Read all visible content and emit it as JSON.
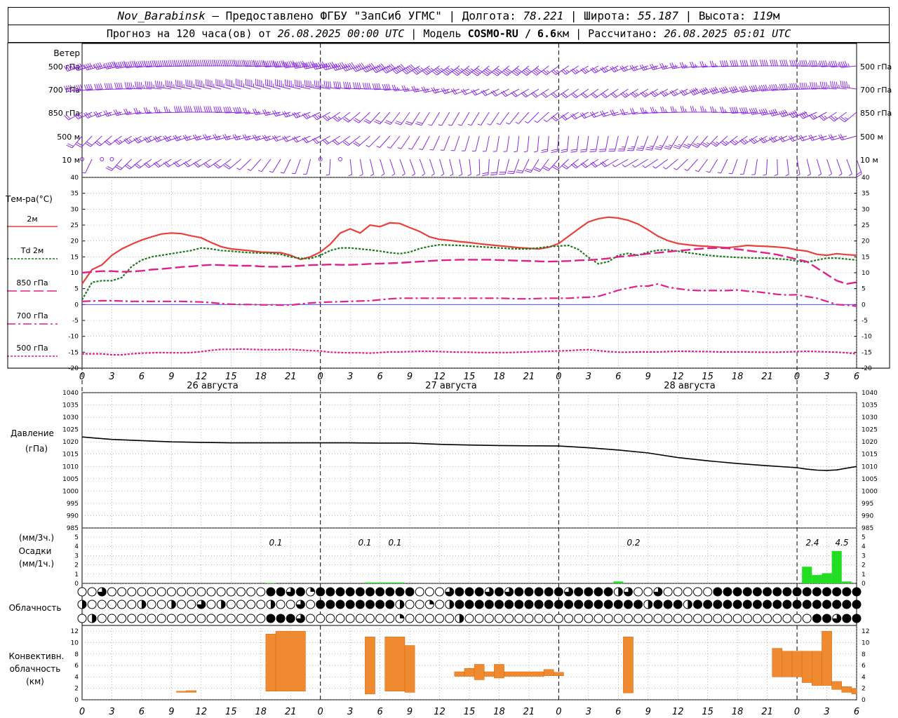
{
  "header": {
    "station": "Nov_Barabinsk",
    "dash": " — ",
    "provider": "Предоставлено ФГБУ \"ЗапСиб УГМС\" | Долгота: ",
    "lon": "78.221",
    "lat_label": " | Широта: ",
    "lat": "55.187",
    "alt_label": " | Высота: ",
    "alt": "119",
    "alt_unit": "м",
    "line2_a": "Прогноз на 120 часа(ов) от ",
    "run_time": "26.08.2025 00:00 UTC",
    "line2_b": " | Модель ",
    "model": "COSMO-RU / 6.6",
    "model_unit": "км",
    "line2_c": " | Рассчитано: ",
    "calc_time": "26.08.2025 05:01 UTC"
  },
  "wind_panel": {
    "title": "Ветер",
    "levels": [
      "500 гПа",
      "700 гПа",
      "850 гПа",
      "500 м",
      "10  м"
    ],
    "color": "#8a2be2"
  },
  "temp_panel": {
    "title": "Тем-ра(°C)",
    "legend": [
      "2м",
      "Td  2м",
      "850 гПа",
      "700 гПа",
      "500 гПа"
    ],
    "yticks": [
      "40",
      "35",
      "30",
      "25",
      "20",
      "15",
      "10",
      "5",
      "0",
      "-5",
      "-10",
      "-15",
      "-20"
    ]
  },
  "pressure_panel": {
    "title": "Давление",
    "unit": "(гПа)",
    "yticks": [
      "1040",
      "1035",
      "1030",
      "1025",
      "1020",
      "1015",
      "1010",
      "1005",
      "1000",
      "995",
      "990",
      "985"
    ]
  },
  "precip_panel": {
    "title_a": "(мм/3ч.)",
    "title_b": "Осадки",
    "title_c": "(мм/1ч.)",
    "yticks": [
      "5",
      "4",
      "3",
      "2",
      "1",
      "0"
    ],
    "labels": [
      "0.1",
      "0.1",
      "0.1",
      "0.2",
      "2.4",
      "4.5"
    ]
  },
  "cloud_panel": {
    "title": "Облачность"
  },
  "conv_panel": {
    "title_a": "Конвективн.",
    "title_b": "облачность",
    "title_c": "(км)",
    "yticks": [
      "12",
      "10",
      "8",
      "6",
      "4",
      "2",
      "0"
    ]
  },
  "time_axis": {
    "hour_labels": [
      "0",
      "3",
      "6",
      "9",
      "12",
      "15",
      "18",
      "21",
      "0",
      "3",
      "6",
      "9",
      "12",
      "15",
      "18",
      "21",
      "0",
      "3",
      "6",
      "9",
      "12",
      "15",
      "18",
      "21",
      "0",
      "3",
      "6"
    ],
    "dates": [
      "26 августа",
      "27 августа",
      "28 августа"
    ]
  },
  "colors": {
    "t2m": "#e8403a",
    "td2m": "#1b7a1b",
    "t850": "#e0208c",
    "wind": "#8a2be2",
    "precip": "#22dd22",
    "conv": "#f08a30"
  },
  "chart_data": [
    {
      "type": "line",
      "title": "Тем-ра(°C)",
      "x_hours": [
        0,
        1,
        2,
        3,
        4,
        5,
        6,
        7,
        8,
        9,
        10,
        11,
        12,
        13,
        14,
        15,
        16,
        17,
        18,
        19,
        20,
        21,
        22,
        23,
        24,
        25,
        26,
        27,
        28,
        29,
        30,
        31,
        32,
        33,
        34,
        35,
        36,
        37,
        38,
        39,
        40,
        41,
        42,
        43,
        44,
        45,
        46,
        47,
        48,
        49,
        50,
        51,
        52,
        53,
        54,
        55,
        56,
        57,
        58,
        59,
        60,
        61,
        62,
        63,
        64,
        65,
        66,
        67,
        68,
        69,
        70,
        71,
        72,
        73,
        74,
        75,
        76,
        77,
        78
      ],
      "ylim": [
        -20,
        40
      ],
      "series": [
        {
          "name": "2м",
          "values": [
            6.5,
            11,
            12.5,
            15.5,
            17.5,
            19,
            20.3,
            21.3,
            22.2,
            22.5,
            22.3,
            21.6,
            21,
            19.5,
            18.2,
            17.5,
            17.2,
            16.9,
            16.5,
            16.4,
            16.3,
            15.5,
            14.2,
            15,
            16.5,
            19,
            22.5,
            23.8,
            22.5,
            25,
            24.5,
            25.7,
            25.5,
            24.2,
            23,
            21.3,
            20.5,
            20.2,
            19.8,
            19.5,
            19.1,
            18.8,
            18.5,
            18.2,
            17.9,
            17.7,
            17.5,
            18,
            19.2,
            21.5,
            23.8,
            26,
            27,
            27.5,
            27.2,
            26.5,
            25.3,
            23.5,
            21.5,
            20.1,
            19.2,
            18.8,
            18.5,
            18.3,
            18.1,
            17.9,
            18.2,
            18.6,
            18.4,
            18.3,
            18.1,
            17.8,
            17.2,
            16.8,
            15.8,
            15.5,
            16,
            15.7,
            15.5
          ]
        },
        {
          "name": "Td  2м",
          "values": [
            1.5,
            7,
            7.5,
            7.5,
            8.5,
            12,
            14,
            15,
            15.5,
            16,
            16.5,
            17,
            17.8,
            17.5,
            17,
            16.8,
            16.5,
            16.3,
            16.2,
            16.1,
            15.8,
            15,
            14.5,
            14.5,
            15.5,
            17,
            17.8,
            17.8,
            17.5,
            17.2,
            16.8,
            16.3,
            16,
            16.5,
            17.6,
            18.3,
            18.8,
            18.7,
            18.6,
            18.4,
            18.2,
            18,
            17.8,
            17.6,
            17.5,
            17.5,
            17.8,
            18.2,
            18.4,
            18.6,
            17.3,
            14.8,
            12.8,
            13.5,
            15.5,
            16.1,
            15.5,
            16.5,
            17.1,
            17.2,
            16.8,
            16.3,
            15.9,
            15.5,
            15.2,
            15,
            14.8,
            14.7,
            14.6,
            14.6,
            14.4,
            14.2,
            13.7,
            13.3,
            14,
            14.6,
            14.6,
            14.3,
            14
          ]
        },
        {
          "name": "850 гПа",
          "values": [
            10,
            10.3,
            10.5,
            10.5,
            10.3,
            10.4,
            10.6,
            11,
            11.2,
            11.5,
            11.8,
            12,
            12.3,
            12.5,
            12.4,
            12.3,
            12.2,
            12.2,
            12,
            11.9,
            11.9,
            12,
            12.2,
            12.4,
            12.5,
            12.6,
            12.5,
            12.5,
            12.6,
            12.8,
            12.9,
            13,
            13.1,
            13.3,
            13.5,
            13.7,
            13.9,
            14,
            14.1,
            14.1,
            14.1,
            14.1,
            14,
            13.9,
            13.8,
            13.7,
            13.6,
            13.5,
            13.6,
            13.7,
            13.9,
            14,
            14.2,
            14.5,
            15,
            15.3,
            15.6,
            16,
            16.3,
            16.6,
            16.9,
            17.2,
            17.5,
            17.7,
            17.8,
            17.7,
            17.4,
            17,
            16.6,
            16.2,
            15.7,
            15,
            14.2,
            13.5,
            11.5,
            9.5,
            7.5,
            6.5,
            7
          ]
        },
        {
          "name": "700 гПа",
          "values": [
            1,
            1.1,
            1.2,
            1.2,
            1.1,
            1,
            1,
            1,
            1,
            1,
            1,
            0.9,
            0.8,
            0.6,
            0.3,
            0.1,
            0,
            0,
            -0.1,
            -0.1,
            -0.2,
            -0.2,
            0.2,
            0.5,
            0.7,
            0.8,
            0.9,
            1,
            1.1,
            1.2,
            1.5,
            1.8,
            2,
            2,
            2,
            2,
            2,
            2,
            2,
            2,
            2,
            2,
            2,
            1.9,
            1.8,
            1.8,
            1.9,
            2,
            2,
            2,
            2.2,
            2.3,
            2.6,
            3.5,
            4.5,
            5.2,
            5.8,
            5.8,
            6.5,
            5.5,
            5,
            4.6,
            4.4,
            4.4,
            4.4,
            4.4,
            4.6,
            4.2,
            4,
            3.6,
            3.2,
            3,
            3.1,
            2.5,
            2,
            1,
            0,
            -0.2,
            -0.5
          ]
        },
        {
          "name": "500 гПа",
          "values": [
            -15.5,
            -15.5,
            -15.5,
            -15.8,
            -15.8,
            -15.5,
            -15.3,
            -15.2,
            -15.1,
            -15.2,
            -15.2,
            -15.1,
            -14.8,
            -14.4,
            -14.1,
            -14.1,
            -14,
            -14.1,
            -14.2,
            -14.2,
            -14.2,
            -14.1,
            -14.3,
            -14.5,
            -14.6,
            -15,
            -15.1,
            -15.2,
            -15.2,
            -15.3,
            -15.1,
            -14.9,
            -14.9,
            -14.8,
            -14.7,
            -14.7,
            -14.8,
            -14.9,
            -15,
            -15,
            -15.1,
            -15.1,
            -15.1,
            -15.1,
            -15,
            -14.9,
            -14.8,
            -14.7,
            -14.6,
            -14.5,
            -14.3,
            -14.2,
            -14.5,
            -14.8,
            -15,
            -15,
            -14.9,
            -14.9,
            -14.9,
            -14.8,
            -14.7,
            -14.7,
            -14.8,
            -14.8,
            -14.9,
            -14.9,
            -14.9,
            -14.9,
            -15,
            -15,
            -15,
            -14.9,
            -14.8,
            -14.7,
            -14.8,
            -14.9,
            -15,
            -15.2,
            -15.5
          ]
        }
      ]
    },
    {
      "type": "line",
      "title": "Давление",
      "ylabel": "(гПа)",
      "ylim": [
        985,
        1040
      ],
      "x_hours": [
        0,
        3,
        6,
        9,
        12,
        15,
        18,
        21,
        24,
        27,
        30,
        33,
        36,
        39,
        42,
        45,
        48,
        51,
        54,
        57,
        60,
        63,
        66,
        69,
        72,
        73,
        74,
        75,
        76,
        77,
        78
      ],
      "series": [
        {
          "name": "Давление",
          "values": [
            1022,
            1021,
            1020.5,
            1020,
            1019.8,
            1019.6,
            1019.6,
            1019.6,
            1019.6,
            1019.6,
            1019.5,
            1019.5,
            1019,
            1018.7,
            1018.5,
            1018.4,
            1018.3,
            1017.6,
            1016.7,
            1015.5,
            1013.6,
            1012.3,
            1011.2,
            1010.3,
            1009.5,
            1008.9,
            1008.5,
            1008.4,
            1008.6,
            1009.3,
            1010
          ]
        }
      ]
    },
    {
      "type": "bar",
      "title": "Осадки",
      "ylabel": "(мм/3ч.) (мм/1ч.)",
      "ylim": [
        0,
        5
      ],
      "x_hours": [
        19,
        29,
        30,
        31,
        32,
        54,
        73,
        74,
        75,
        76,
        77
      ],
      "values": [
        0.05,
        0.1,
        0.1,
        0.1,
        0.1,
        0.2,
        1.8,
        0.9,
        1.1,
        3.5,
        0.2
      ]
    },
    {
      "type": "bar",
      "title": "Конвективн. облачность",
      "ylabel": "(км)",
      "ylim": [
        0,
        13
      ],
      "bars": [
        {
          "from": 9.5,
          "to": 10.5,
          "base": 1.3,
          "top": 1.5
        },
        {
          "from": 10.5,
          "to": 11.5,
          "base": 1.3,
          "top": 1.6
        },
        {
          "from": 18.5,
          "to": 19.5,
          "base": 1.5,
          "top": 11.5
        },
        {
          "from": 19.5,
          "to": 22.5,
          "base": 1.5,
          "top": 12
        },
        {
          "from": 28.5,
          "to": 29.5,
          "base": 1,
          "top": 11
        },
        {
          "from": 30.5,
          "to": 32.5,
          "base": 1.5,
          "top": 11
        },
        {
          "from": 32.5,
          "to": 33.5,
          "base": 1.3,
          "top": 9.5
        },
        {
          "from": 37.5,
          "to": 38.5,
          "base": 4.1,
          "top": 4.9
        },
        {
          "from": 38.5,
          "to": 39.5,
          "base": 4.1,
          "top": 5.5
        },
        {
          "from": 39.5,
          "to": 40.5,
          "base": 3.5,
          "top": 6.2
        },
        {
          "from": 40.5,
          "to": 41.5,
          "base": 4.1,
          "top": 4.9
        },
        {
          "from": 41.5,
          "to": 42.5,
          "base": 3.8,
          "top": 6.2
        },
        {
          "from": 42.5,
          "to": 46.5,
          "base": 4.1,
          "top": 4.9
        },
        {
          "from": 46.5,
          "to": 47.5,
          "base": 4.2,
          "top": 5.3
        },
        {
          "from": 47.5,
          "to": 48.5,
          "base": 4.2,
          "top": 4.8
        },
        {
          "from": 54.5,
          "to": 55.5,
          "base": 1.2,
          "top": 11
        },
        {
          "from": 69.5,
          "to": 70.5,
          "base": 4,
          "top": 9
        },
        {
          "from": 70.5,
          "to": 71.5,
          "base": 4,
          "top": 8.5
        },
        {
          "from": 71.5,
          "to": 72.5,
          "base": 4,
          "top": 8.5
        },
        {
          "from": 72.5,
          "to": 73.5,
          "base": 3,
          "top": 8.5
        },
        {
          "from": 73.5,
          "to": 74.5,
          "base": 2.5,
          "top": 8.5
        },
        {
          "from": 74.5,
          "to": 75.5,
          "base": 2.5,
          "top": 12
        },
        {
          "from": 75.5,
          "to": 76.5,
          "base": 1.8,
          "top": 3.2
        },
        {
          "from": 76.5,
          "to": 77.5,
          "base": 1.3,
          "top": 2.3
        },
        {
          "from": 77.5,
          "to": 78,
          "base": 1,
          "top": 2
        }
      ]
    }
  ]
}
